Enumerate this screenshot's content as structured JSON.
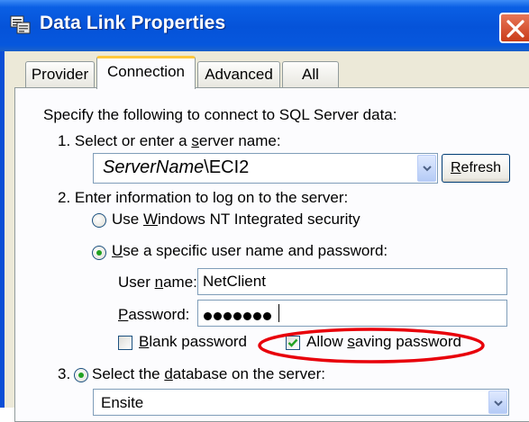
{
  "window": {
    "title": "Data Link Properties",
    "icon": "data-link-icon",
    "close_icon": "close-icon"
  },
  "tabs": [
    {
      "label": "Provider",
      "active": false
    },
    {
      "label": "Connection",
      "active": true
    },
    {
      "label": "Advanced",
      "active": false
    },
    {
      "label": "All",
      "active": false
    }
  ],
  "connection": {
    "intro": "Specify the following to connect to SQL Server data:",
    "step1": {
      "pre": "1. Select or enter a ",
      "accel": "s",
      "post": "erver name:"
    },
    "server_name_italic": "ServerName",
    "server_name_rest": "\\ECI2",
    "refresh": {
      "accel": "R",
      "rest": "efresh"
    },
    "step2": "2. Enter information to log on to the server:",
    "radio_nt": {
      "pre": "Use ",
      "accel": "W",
      "post": "indows NT Integrated security",
      "selected": false
    },
    "radio_specific": {
      "accel": "U",
      "post": "se a specific user name and password:",
      "selected": true
    },
    "username_label": {
      "pre": "User ",
      "accel": "n",
      "post": "ame:"
    },
    "username_value": "NetClient",
    "password_label": {
      "accel": "P",
      "post": "assword:"
    },
    "password_length": 7,
    "blank_password": {
      "accel": "B",
      "post": "lank password",
      "checked": false
    },
    "allow_saving": {
      "pre": "Allow ",
      "accel": "s",
      "post": "aving password",
      "checked": true
    },
    "step3": {
      "num": "3.",
      "pre": "Select the ",
      "accel": "d",
      "post": "atabase on the server:",
      "selected": true
    },
    "database_value": "Ensite"
  },
  "colors": {
    "titlebar": "#0553d9",
    "highlight_ellipse": "#e8000a",
    "tab_active_accent": "#ffc83c",
    "radio_dot": "#21a121"
  }
}
